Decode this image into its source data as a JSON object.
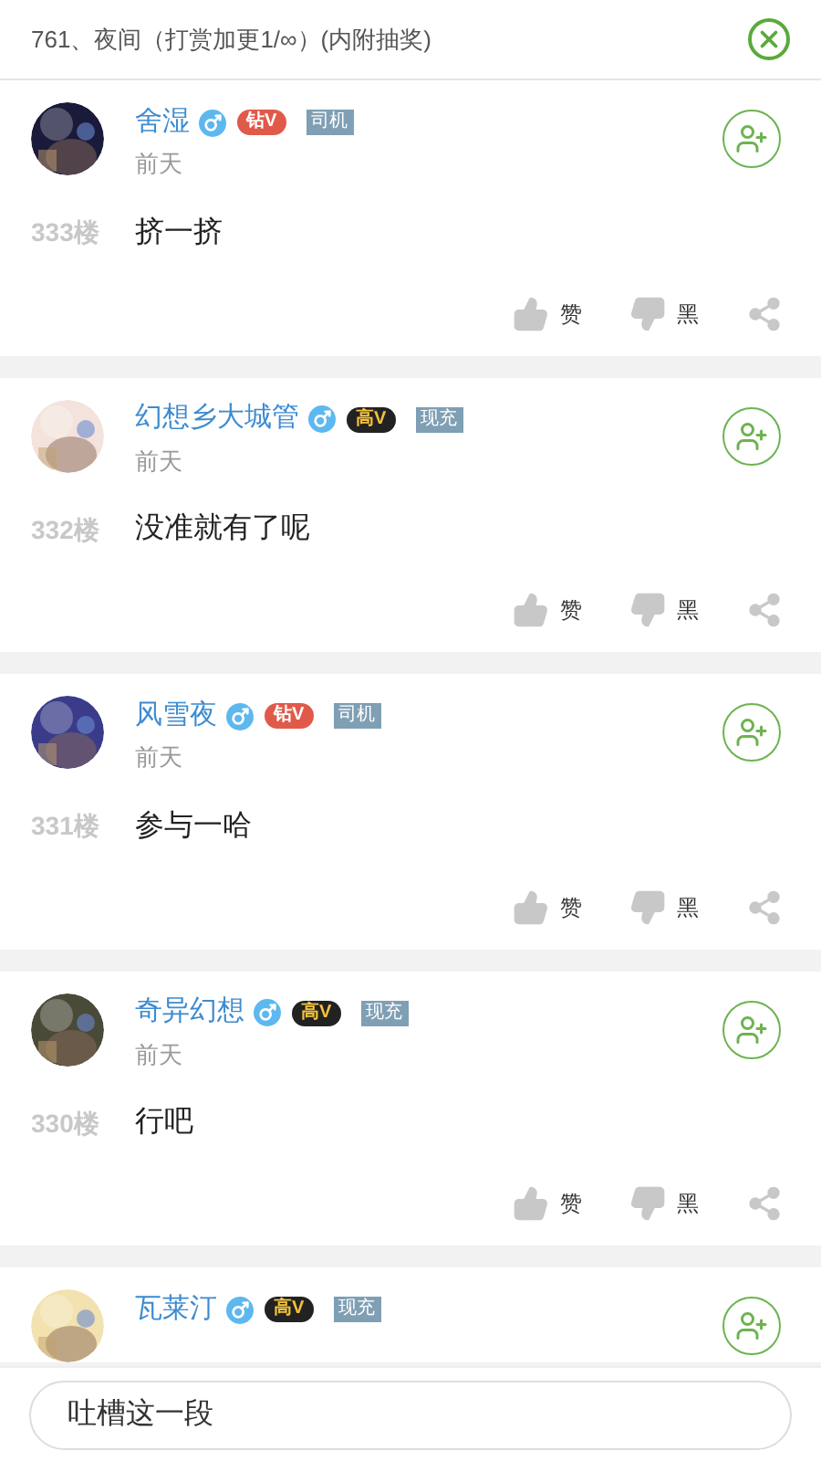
{
  "header": {
    "title": "761、夜间（打赏加更1/∞）(内附抽奖)"
  },
  "comments": [
    {
      "name": "舍湿",
      "vip": {
        "kind": "diamond",
        "label": "钻V"
      },
      "tag": "司机",
      "time": "前天",
      "floor": "333楼",
      "body": "挤一挤",
      "like": "赞",
      "dislike": "黑"
    },
    {
      "name": "幻想乡大城管",
      "vip": {
        "kind": "high",
        "label": "高V"
      },
      "tag": "现充",
      "time": "前天",
      "floor": "332楼",
      "body": "没准就有了呢",
      "like": "赞",
      "dislike": "黑"
    },
    {
      "name": "风雪夜",
      "vip": {
        "kind": "diamond",
        "label": "钻V"
      },
      "tag": "司机",
      "time": "前天",
      "floor": "331楼",
      "body": "参与一哈",
      "like": "赞",
      "dislike": "黑"
    },
    {
      "name": "奇异幻想",
      "vip": {
        "kind": "high",
        "label": "高V"
      },
      "tag": "现充",
      "time": "前天",
      "floor": "330楼",
      "body": "行吧",
      "like": "赞",
      "dislike": "黑"
    },
    {
      "name": "瓦莱汀",
      "vip": {
        "kind": "high",
        "label": "高V"
      },
      "tag": "现充"
    }
  ],
  "input": {
    "placeholder": "吐槽这一段"
  }
}
